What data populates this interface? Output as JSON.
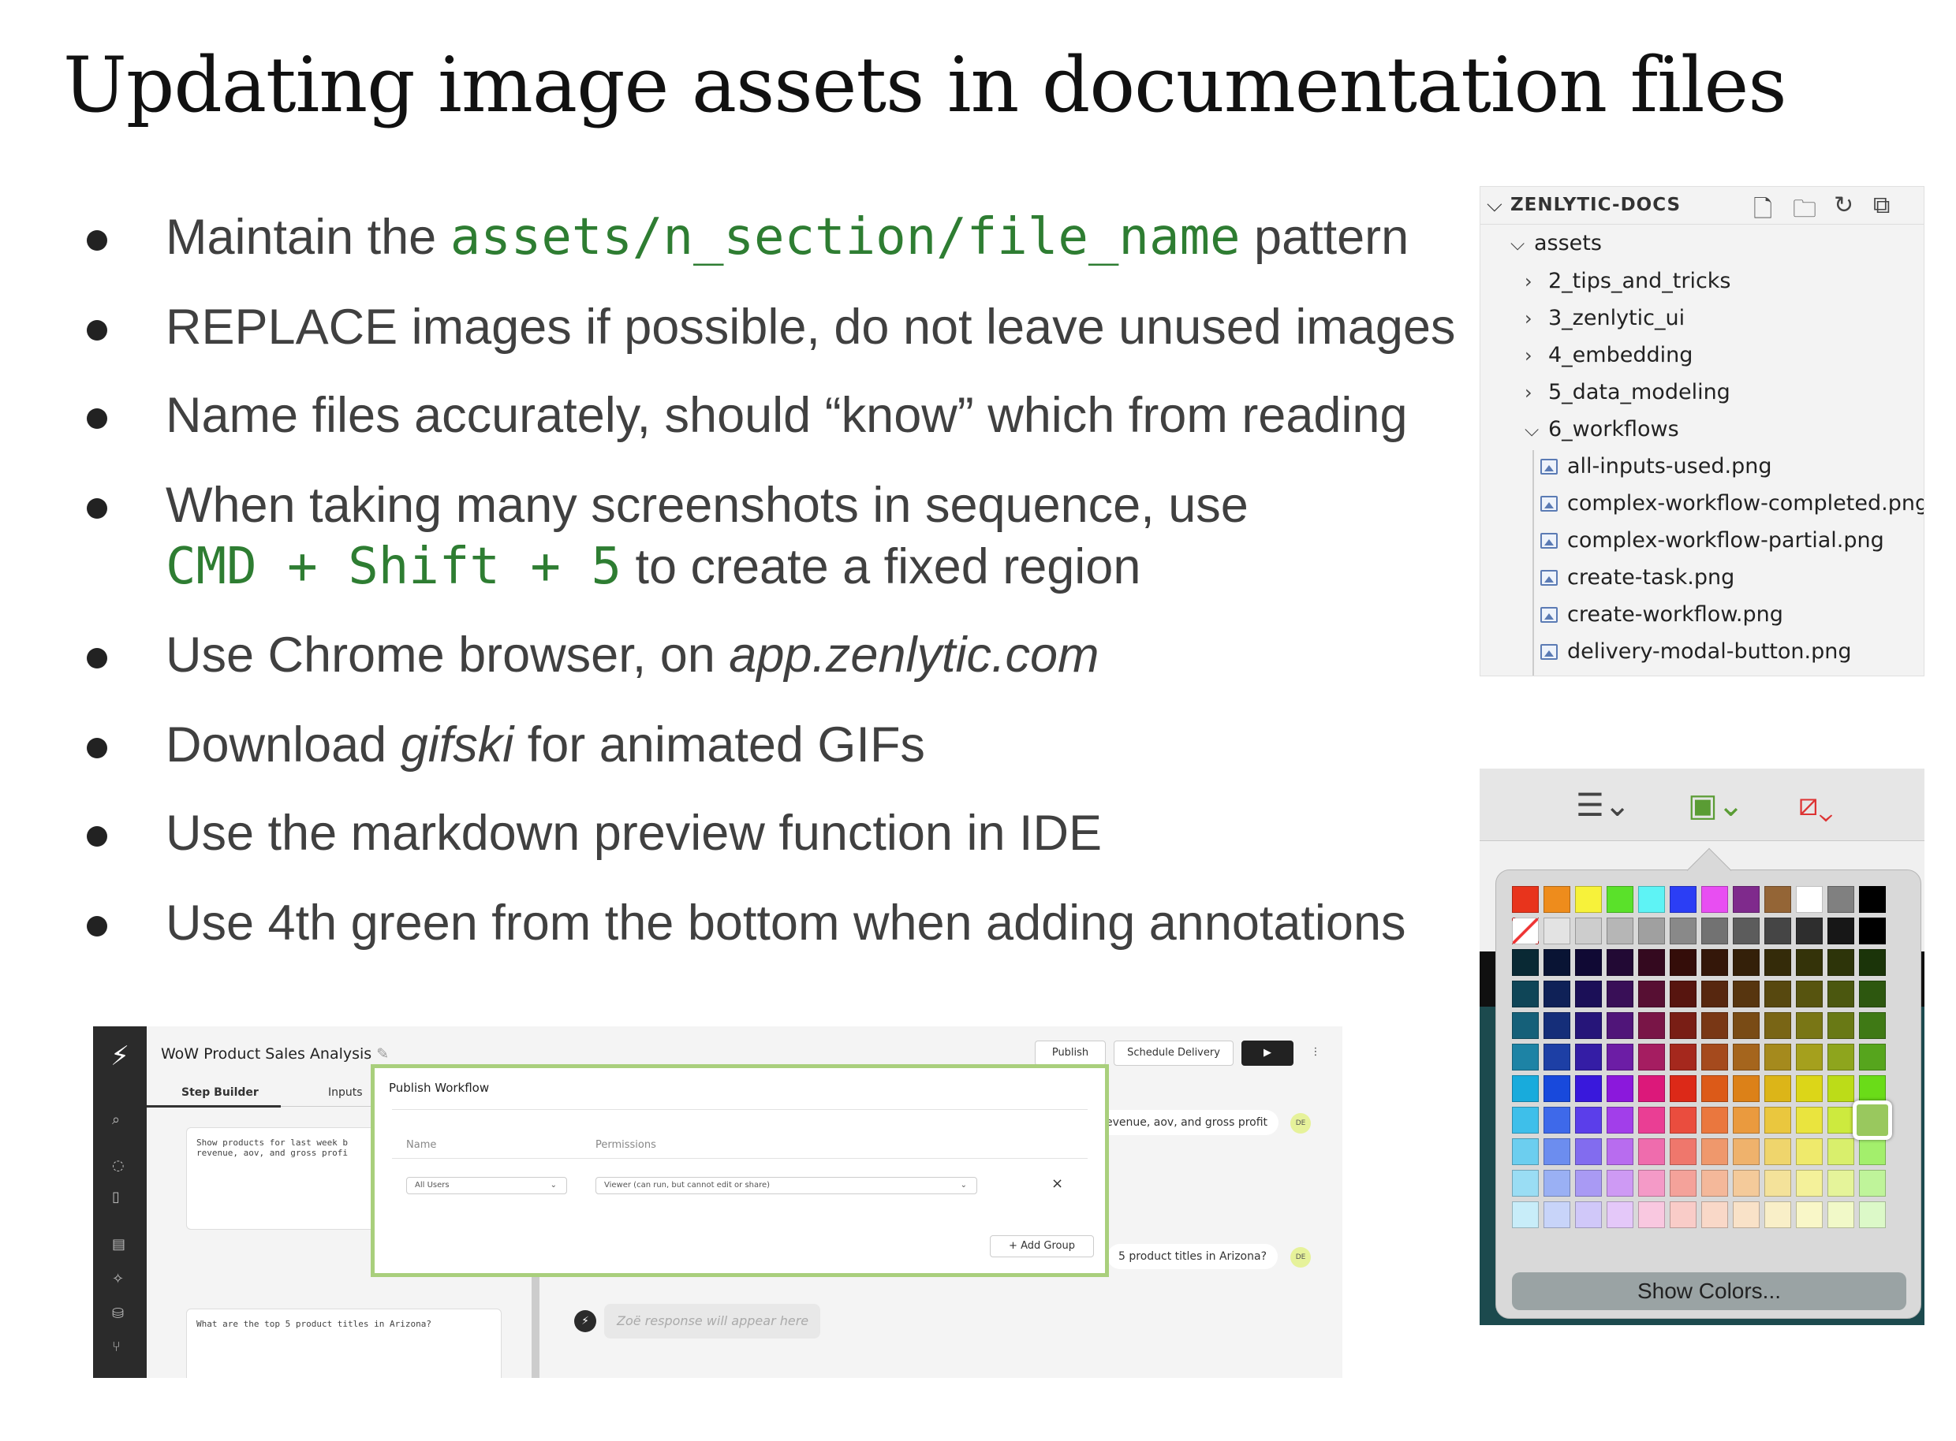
{
  "title": "Updating image assets in documentation files",
  "bullets": {
    "b1": {
      "pre": "Maintain the ",
      "code": "assets/n_section/file_name",
      "post": " pattern"
    },
    "b2": "REPLACE images if possible, do not leave unused images",
    "b3": "Name files accurately, should “know” which from reading",
    "b4": {
      "line1": "When taking many screenshots in sequence, use",
      "code": "CMD + Shift + 5",
      "post": " to create a fixed region"
    },
    "b5": {
      "pre": "Use Chrome browser, on ",
      "ital": "app.zenlytic.com"
    },
    "b6": {
      "pre": "Download ",
      "ital": "gifski",
      "post": " for animated GIFs"
    },
    "b7": "Use the markdown preview function in IDE",
    "b8": "Use 4th green from the bottom when adding annotations"
  },
  "explorer": {
    "root": "ZENLYTIC-DOCS",
    "folder": "assets",
    "subfolders": [
      "2_tips_and_tricks",
      "3_zenlytic_ui",
      "4_embedding",
      "5_data_modeling",
      "6_workflows"
    ],
    "files": [
      "all-inputs-used.png",
      "complex-workflow-completed.png",
      "complex-workflow-partial.png",
      "create-task.png",
      "create-workflow.png",
      "delivery-modal-button.png"
    ],
    "icons": [
      "new-file-icon",
      "new-folder-icon",
      "refresh-icon",
      "collapse-all-icon"
    ]
  },
  "picker": {
    "show_colors": "Show Colors...",
    "top_row": [
      "#e8341c",
      "#ee8c1c",
      "#f7f23a",
      "#5ae12a",
      "#5ef3f5",
      "#2b3ef5",
      "#e84ef2",
      "#7f2a8c",
      "#946536",
      "#ffffff",
      "#808080",
      "#000000"
    ],
    "gray_row": [
      "#ffffff",
      "#e3e3e3",
      "#cdcdcd",
      "#b6b6b6",
      "#a0a0a0",
      "#898989",
      "#727272",
      "#5c5c5c",
      "#454545",
      "#2e2e2e",
      "#171717",
      "#000000"
    ],
    "selected": "#99c85e"
  },
  "app": {
    "title": "WoW Product Sales Analysis",
    "publish": "Publish",
    "schedule": "Schedule Delivery",
    "tab_step_builder": "Step Builder",
    "tab_inputs": "Inputs",
    "step1_line1": "Show products for last week b",
    "step1_line2": "revenue, aov, and gross profi",
    "step2": "What are the top 5 product titles in Arizona?",
    "modal_title": "Publish Workflow",
    "col_name": "Name",
    "col_permissions": "Permissions",
    "sel_users": "All Users",
    "sel_perm": "Viewer (can run, but cannot edit or share)",
    "add_group": "+ Add Group",
    "chat1": "evenue, aov, and gross profit",
    "chat2": "5 product titles in Arizona?",
    "avatar": "DE",
    "response": "Zoë response will appear here"
  }
}
